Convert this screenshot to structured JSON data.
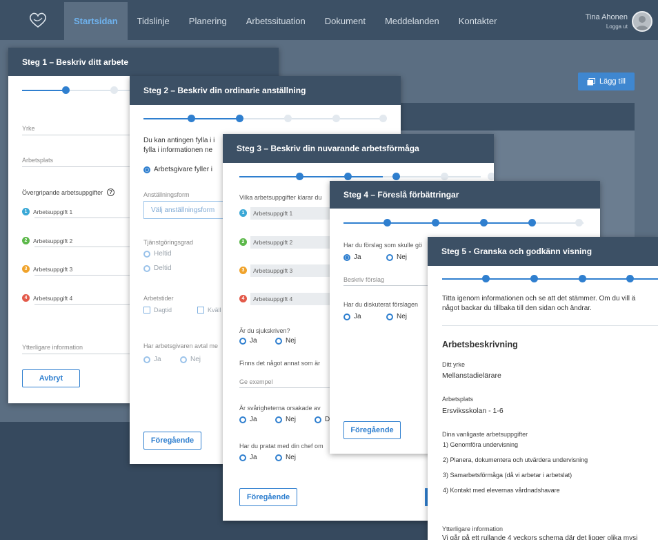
{
  "nav": {
    "tabs": [
      "Startsidan",
      "Tidslinje",
      "Planering",
      "Arbetssituation",
      "Dokument",
      "Meddelanden",
      "Kontakter"
    ],
    "user_name": "Tina Ahonen",
    "logout": "Logga ut"
  },
  "bg": {
    "add_label": "Lägg till"
  },
  "step1": {
    "title": "Steg 1 – Beskriv ditt arbete",
    "yrke": "Yrke",
    "arbetsplats": "Arbetsplats",
    "tasks_heading": "Övergripande arbetsuppgifter",
    "help": "?",
    "tasks": [
      "Arbetsuppgift 1",
      "Arbetsuppgift 2",
      "Arbetsuppgift 3",
      "Arbetsuppgift 4"
    ],
    "more_info": "Ytterligare information",
    "cancel": "Avbryt"
  },
  "step2": {
    "title": "Steg 2 – Beskriv din ordinarie anställning",
    "intro_1": "Du kan antingen fylla i i",
    "intro_2": "fylla i informationen ne",
    "employer_fills": "Arbetsgivare fyller i",
    "emp_form_label": "Anställningsform",
    "emp_form_placeholder": "Välj anställningsform",
    "degree_label": "Tjänstgöringsgrad",
    "fulltime": "Heltid",
    "parttime": "Deltid",
    "hours_label": "Arbetstider",
    "day": "Dagtid",
    "evening": "Kväll",
    "agreement_label": "Har arbetsgivaren avtal me",
    "yes": "Ja",
    "no": "Nej",
    "prev": "Föregående"
  },
  "step3": {
    "title": "Steg 3 – Beskriv din nuvarande arbetsförmåga",
    "q_tasks": "Vilka arbetsuppgifter klarar du",
    "tasks": [
      "Arbetsuppgift 1",
      "Arbetsuppgift 2",
      "Arbetsuppgift 3",
      "Arbetsuppgift 4"
    ],
    "q_sick": "Är du sjukskriven?",
    "q_other": "Finns det något annat som är",
    "example_placeholder": "Ge exempel",
    "q_cause": "Är svårigheterna orsakade av",
    "q_chef": "Har du pratat med din chef om",
    "yes": "Ja",
    "no": "Nej",
    "d": "D",
    "prev": "Föregående"
  },
  "step4": {
    "title": "Steg 4 – Föreslå förbättringar",
    "q_suggest": "Har du förslag som skulle gö",
    "describe": "Beskriv förslag",
    "q_discussed": "Har du diskuterat förslagen",
    "yes": "Ja",
    "no": "Nej",
    "prev": "Föregående"
  },
  "step5": {
    "title": "Steg 5 - Granska och godkänn visning",
    "intro_1": "Titta igenom informationen och se att det stämmer. Om du vill ä",
    "intro_2": "något backar du tillbaka till den sidan och ändrar.",
    "section": "Arbetsbeskrivning",
    "yrke_label": "Ditt yrke",
    "yrke_value": "Mellanstadielärare",
    "place_label": "Arbetsplats",
    "place_value": "Ersviksskolan - 1-6",
    "tasks_label": "Dina vanligaste arbetsuppgifter",
    "tasks": [
      "1) Genomföra undervisning",
      "2) Planera, dokumentera och utvärdera undervisning",
      "3) Samarbetsförmåga (då vi arbetar i arbetslat)",
      "4) Kontakt med elevernas vårdnadshavare"
    ],
    "more_label": "Ytterligare information",
    "more_value": "Vi går på ett rullande 4 veckors schema där det ligger olika mysi"
  },
  "colors": {
    "nav_bg": "#3c5065",
    "accent": "#2f7fcf",
    "task_colors": [
      "#3aa8d6",
      "#5cb84a",
      "#f0a32b",
      "#e35a4a"
    ]
  }
}
